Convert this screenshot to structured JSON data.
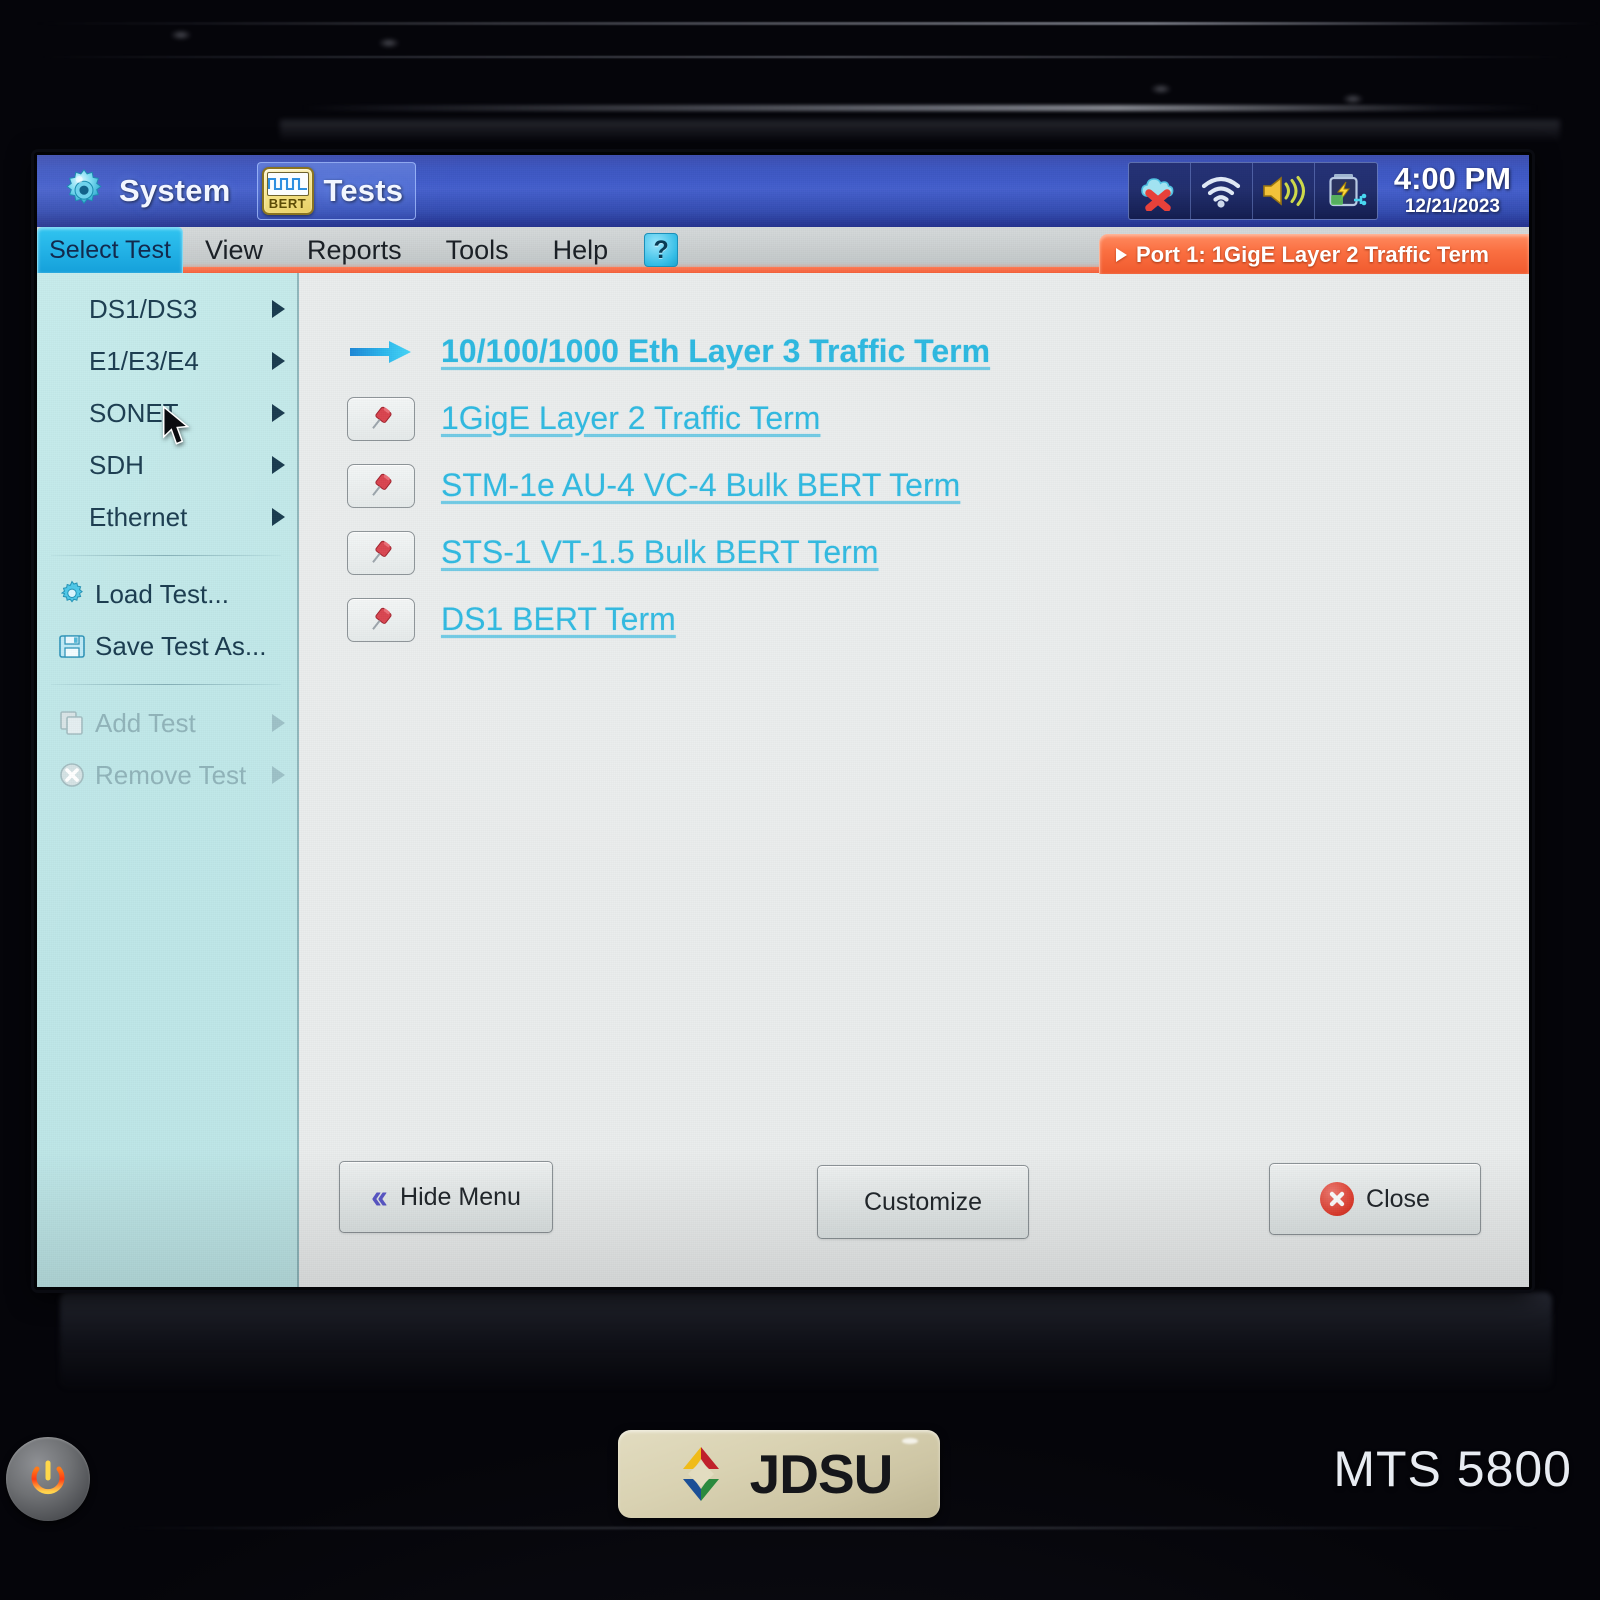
{
  "device": {
    "model_name": "MTS 5800",
    "brand": "JDSU",
    "power_button_name": "power-button"
  },
  "titlebar": {
    "apps": [
      {
        "label": "System",
        "icon": "gear-icon",
        "selected": false
      },
      {
        "label": "Tests",
        "icon": "bert-icon",
        "selected": true
      }
    ],
    "bert_icon_text": "BERT",
    "status_icons": [
      {
        "name": "cloud-disconnected-icon"
      },
      {
        "name": "wifi-icon"
      },
      {
        "name": "volume-icon"
      },
      {
        "name": "battery-charging-icon"
      }
    ],
    "time": "4:00 PM",
    "date": "12/21/2023"
  },
  "menubar": {
    "active_tab": "Select Test",
    "items": [
      {
        "label": "View"
      },
      {
        "label": "Reports"
      },
      {
        "label": "Tools"
      },
      {
        "label": "Help"
      }
    ],
    "help_icon": "context-help-icon",
    "help_icon_glyph": "?",
    "port_tab": {
      "label": "Port 1: 1GigE Layer 2 Traffic Term",
      "color": "#f96b3c"
    }
  },
  "sidebar": {
    "groups": [
      {
        "items": [
          {
            "label": "DS1/DS3",
            "submenu": true,
            "disabled": false,
            "icon": null
          },
          {
            "label": "E1/E3/E4",
            "submenu": true,
            "disabled": false,
            "icon": null
          },
          {
            "label": "SONET",
            "submenu": true,
            "disabled": false,
            "icon": null
          },
          {
            "label": "SDH",
            "submenu": true,
            "disabled": false,
            "icon": null
          },
          {
            "label": "Ethernet",
            "submenu": true,
            "disabled": false,
            "icon": null
          }
        ]
      },
      {
        "items": [
          {
            "label": "Load Test...",
            "submenu": false,
            "disabled": false,
            "icon": "gear-icon"
          },
          {
            "label": "Save Test As...",
            "submenu": false,
            "disabled": false,
            "icon": "save-disk-icon"
          }
        ]
      },
      {
        "items": [
          {
            "label": "Add Test",
            "submenu": true,
            "disabled": true,
            "icon": "copy-icon"
          },
          {
            "label": "Remove Test",
            "submenu": true,
            "disabled": true,
            "icon": "remove-icon"
          }
        ]
      }
    ]
  },
  "test_list": [
    {
      "label": "10/100/1000 Eth Layer 3 Traffic Term",
      "marker": "run-arrow-icon",
      "active": true
    },
    {
      "label": "1GigE Layer 2 Traffic Term",
      "marker": "pin-icon",
      "active": false
    },
    {
      "label": "STM-1e AU-4 VC-4 Bulk BERT Term",
      "marker": "pin-icon",
      "active": false
    },
    {
      "label": "STS-1 VT-1.5 Bulk BERT Term",
      "marker": "pin-icon",
      "active": false
    },
    {
      "label": "DS1 BERT Term",
      "marker": "pin-icon",
      "active": false
    }
  ],
  "buttons": {
    "hide_menu": "Hide Menu",
    "hide_menu_icon": "double-chevron-left-icon",
    "customize": "Customize",
    "close": "Close",
    "close_icon": "close-circle-icon"
  },
  "colors": {
    "titlebar_blue": "#3d58ca",
    "sidebar_cyan": "#bfe7e8",
    "link_cyan": "#2bb8e0",
    "accent_orange": "#f96b3c",
    "active_tab_cyan": "#23b2e6",
    "screen_bg": "#e9ecec"
  }
}
